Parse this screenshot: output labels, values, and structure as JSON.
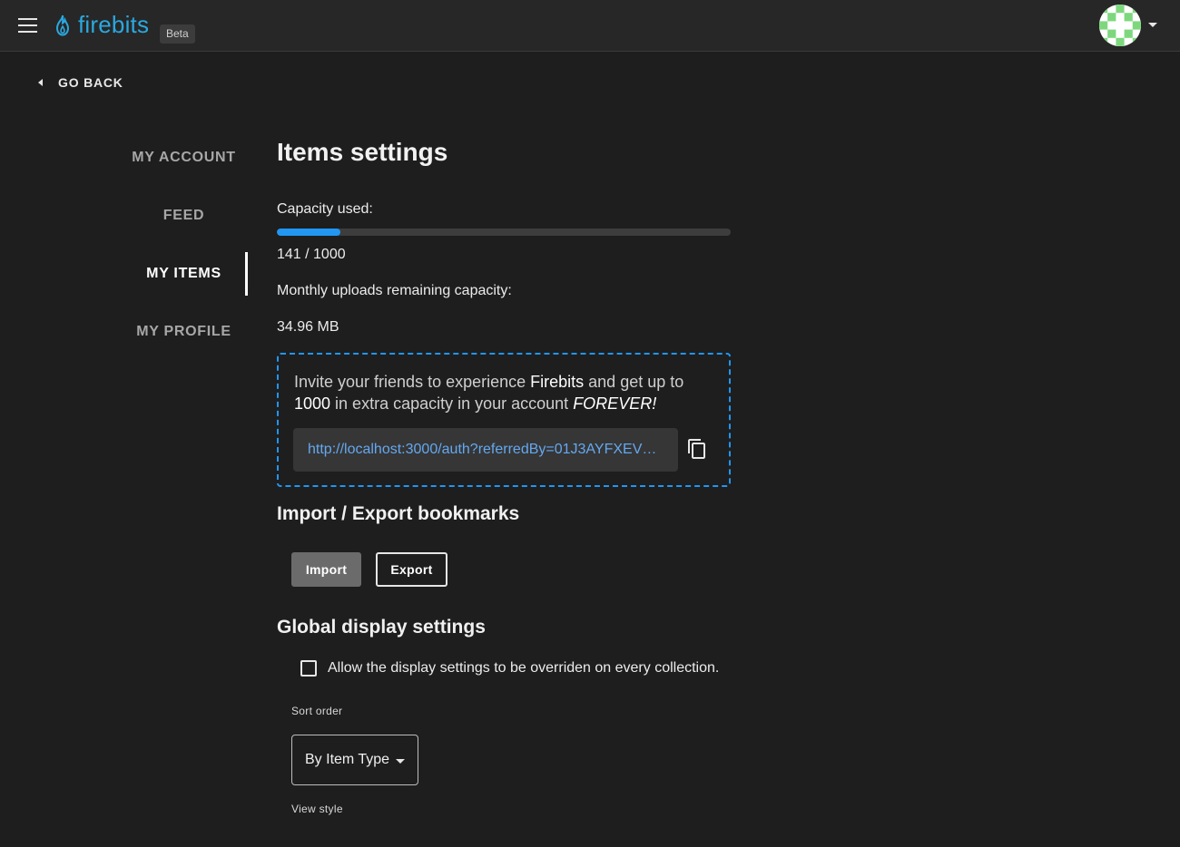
{
  "header": {
    "logo_text": "firebits",
    "beta_badge": "Beta"
  },
  "nav": {
    "go_back": "GO BACK",
    "items": [
      {
        "label": "MY ACCOUNT"
      },
      {
        "label": "FEED"
      },
      {
        "label": "MY ITEMS",
        "active": true
      },
      {
        "label": "MY PROFILE"
      }
    ]
  },
  "main": {
    "title": "Items settings",
    "capacity_label": "Capacity used:",
    "capacity_used": 141,
    "capacity_total": 1000,
    "capacity_text": "141 / 1000",
    "monthly_label": "Monthly uploads remaining capacity:",
    "monthly_value": "34.96 MB",
    "invite": {
      "text_1": "Invite your friends to experience ",
      "brand": "Firebits",
      "text_2": " and get up to ",
      "amount": "1000",
      "text_3": " in extra capacity in your account ",
      "forever": "FOREVER!",
      "link": "http://localhost:3000/auth?referredBy=01J3AYFXEV…"
    },
    "import_export_heading": "Import / Export bookmarks",
    "import_label": "Import",
    "export_label": "Export",
    "global_heading": "Global display settings",
    "override_checkbox_label": "Allow the display settings to be overriden on every collection.",
    "override_checked": false,
    "sort_order_label": "Sort order",
    "sort_order_value": "By Item Type",
    "view_style_label": "View style"
  },
  "colors": {
    "accent": "#2196f3",
    "brand": "#2aa8e0",
    "background": "#1e1e1e",
    "appbar": "#272727"
  },
  "icons": [
    "menu-icon",
    "flame-icon",
    "avatar-identicon",
    "chevron-down-icon",
    "arrow-left-icon",
    "copy-icon",
    "dropdown-icon"
  ]
}
